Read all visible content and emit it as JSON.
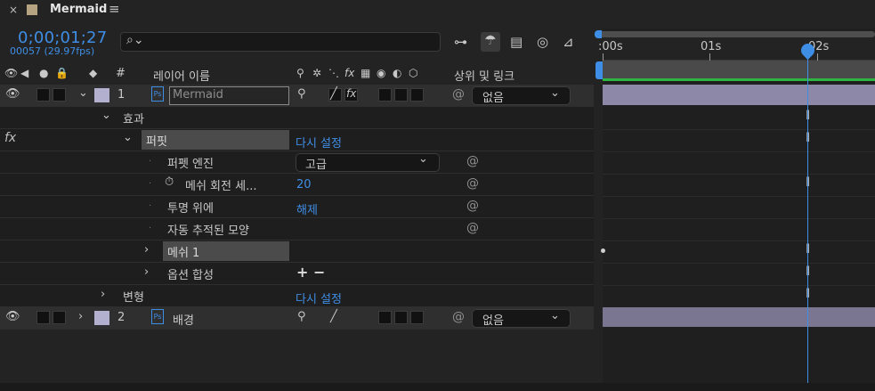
{
  "panel": {
    "close_icon": "×",
    "color": "#b5a381",
    "title": "Mermaid",
    "menu_icon": "≡"
  },
  "time": {
    "timecode": "0;00;01;27",
    "frames": "00057 (29.97fps)"
  },
  "search": {
    "icon": "🔍",
    "value": ""
  },
  "headers": {
    "hash": "#",
    "layer_name": "레이어 이름",
    "parent": "상위 및 링크",
    "fx": "fx"
  },
  "layers": [
    {
      "index": "1",
      "name": "Mermaid",
      "parent": "없음"
    },
    {
      "index": "2",
      "name": "배경",
      "parent": "없음"
    }
  ],
  "properties": {
    "effects": "효과",
    "fx_badge": "fx",
    "puppet": "퍼핏",
    "reset1": "다시 설정",
    "engine_label": "퍼펫 엔진",
    "engine_value": "고급",
    "mesh_rotation_label": "메쉬 회전 세...",
    "mesh_rotation_value": "20",
    "on_transparent_label": "투명 위에",
    "on_transparent_value": "해제",
    "auto_traced_label": "자동 추적된 모양",
    "mesh1_label": "메쉬 1",
    "options_label": "옵션 합성",
    "options_value": "+ −",
    "transform_label": "변형",
    "reset2": "다시 설정"
  },
  "timeline": {
    "ticks": [
      ":00s",
      "01s",
      "02s"
    ],
    "playhead_time_s": 1.9
  },
  "colors": {
    "accent": "#3f8ee6",
    "label_lavender": "#b3b0cf",
    "work_area_green": "#2fb642",
    "layer_bar": "#8e88a8"
  }
}
